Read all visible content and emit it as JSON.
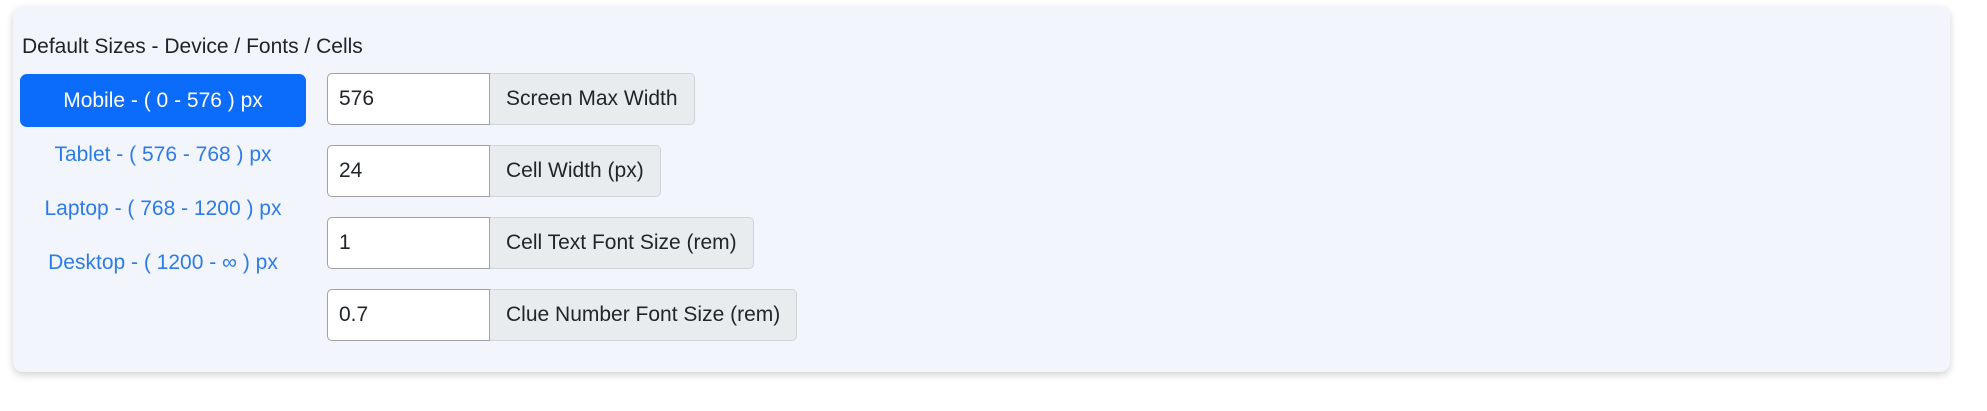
{
  "section": {
    "title": "Default Sizes - Device / Fonts / Cells"
  },
  "device_tabs": [
    {
      "label": "Mobile - ( 0 - 576 ) px",
      "active": true
    },
    {
      "label": "Tablet - ( 576 - 768 ) px",
      "active": false
    },
    {
      "label": "Laptop - ( 768 - 1200 ) px",
      "active": false
    },
    {
      "label": "Desktop - ( 1200 - ∞ ) px",
      "active": false
    }
  ],
  "fields": [
    {
      "value": "576",
      "label": "Screen Max Width"
    },
    {
      "value": "24",
      "label": "Cell Width (px)"
    },
    {
      "value": "1",
      "label": "Cell Text Font Size (rem)"
    },
    {
      "value": "0.7",
      "label": "Clue Number Font Size (rem)"
    }
  ],
  "colors": {
    "accent": "#0b6cfb",
    "link": "#2d7be8",
    "card_background": "#f2f5fc"
  }
}
